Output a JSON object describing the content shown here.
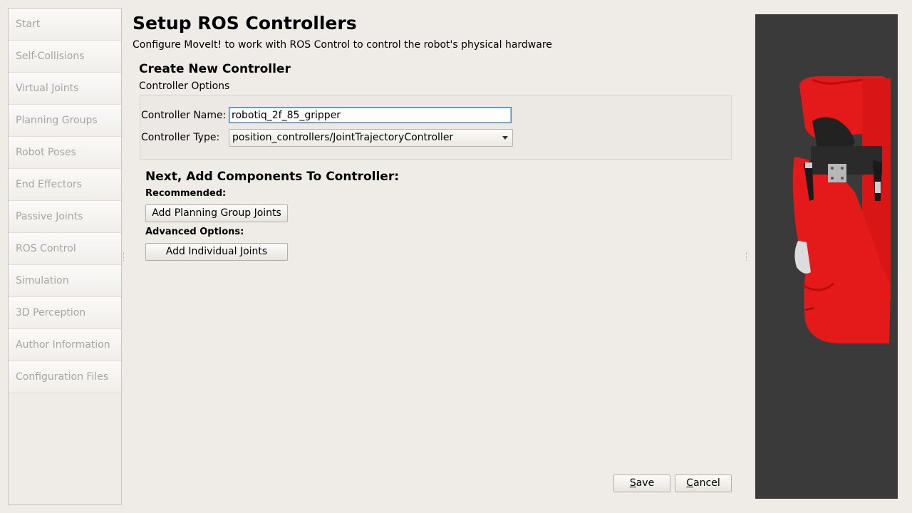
{
  "sidebar": {
    "items": [
      {
        "label": "Start"
      },
      {
        "label": "Self-Collisions"
      },
      {
        "label": "Virtual Joints"
      },
      {
        "label": "Planning Groups"
      },
      {
        "label": "Robot Poses"
      },
      {
        "label": "End Effectors"
      },
      {
        "label": "Passive Joints"
      },
      {
        "label": "ROS Control"
      },
      {
        "label": "Simulation"
      },
      {
        "label": "3D Perception"
      },
      {
        "label": "Author Information"
      },
      {
        "label": "Configuration Files"
      }
    ]
  },
  "header": {
    "title": "Setup ROS Controllers",
    "description": "Configure MoveIt! to work with ROS Control to control the robot's physical hardware"
  },
  "create": {
    "title": "Create New Controller",
    "options_label": "Controller Options",
    "name_label": "Controller Name:",
    "name_value": "robotiq_2f_85_gripper",
    "type_label": "Controller Type:",
    "type_value": "position_controllers/JointTrajectoryController"
  },
  "components": {
    "title": "Next, Add Components To Controller:",
    "recommended_label": "Recommended:",
    "planning_group_button": "Add Planning Group Joints",
    "advanced_label": "Advanced Options:",
    "individual_button": "Add Individual Joints"
  },
  "footer": {
    "save_pre": "",
    "save_key": "S",
    "save_rest": "ave",
    "cancel_key": "C",
    "cancel_rest": "ancel"
  },
  "colors": {
    "robot": "#e41a1a",
    "viewport_bg": "#3a3a3a"
  }
}
